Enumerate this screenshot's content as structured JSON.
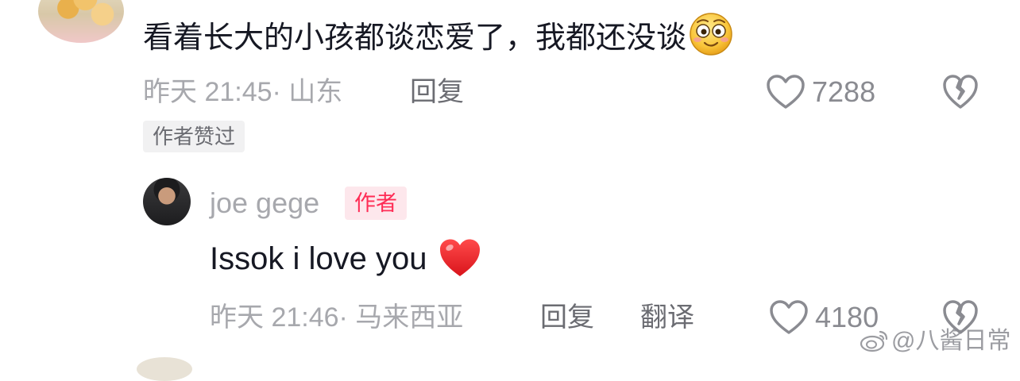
{
  "top_comment": {
    "text": "看着长大的小孩都谈恋爱了，我都还没谈",
    "emoji": "smiling-face-emoji",
    "time": "昨天 21:45",
    "location": "· 山东",
    "reply_label": "回复",
    "like_count": "7288",
    "author_liked_badge": "作者赞过"
  },
  "reply": {
    "username": "joe gege",
    "author_badge": "作者",
    "text": "Issok i love you",
    "emoji": "red-heart-emoji",
    "time": "昨天 21:46",
    "location": "· 马来西亚",
    "reply_label": "回复",
    "translate_label": "翻译",
    "like_count": "4180"
  },
  "watermark": {
    "text": "@八酱日常"
  },
  "colors": {
    "text_primary": "#161823",
    "text_secondary": "#a7a8ad",
    "author_red": "#fe2c55",
    "author_badge_bg": "#fde7ec",
    "badge_bg": "#f1f1f2"
  }
}
